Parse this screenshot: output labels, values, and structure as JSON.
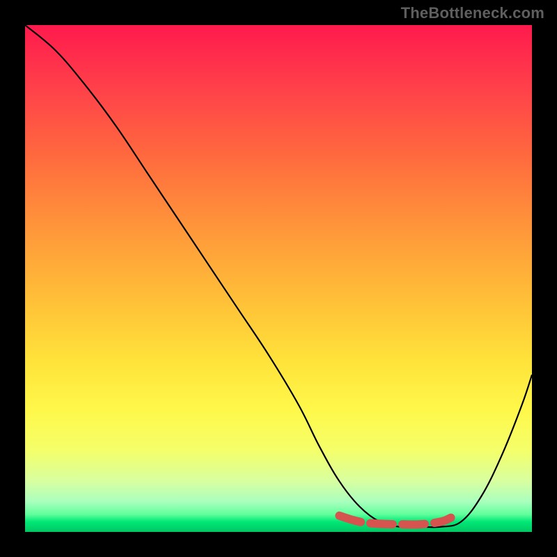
{
  "watermark": "TheBottleneck.com",
  "chart_data": {
    "type": "line",
    "title": "",
    "xlabel": "",
    "ylabel": "",
    "xlim": [
      0,
      100
    ],
    "ylim": [
      0,
      100
    ],
    "background_gradient": {
      "top": "#ff1a4d",
      "bottom": "#00c763",
      "meaning": "bottleneck severity high (red) to low (green)"
    },
    "series": [
      {
        "name": "bottleneck-curve",
        "color": "#000000",
        "stroke_width": 2,
        "x": [
          0,
          6,
          12,
          18,
          24,
          30,
          36,
          42,
          48,
          54,
          58,
          62,
          66,
          70,
          74,
          78,
          82,
          86,
          90,
          94,
          98,
          100
        ],
        "y": [
          100,
          95,
          88,
          80,
          71,
          62,
          53,
          44,
          35,
          25,
          17,
          10,
          5,
          2,
          1,
          1,
          1,
          2,
          7,
          15,
          25,
          31
        ]
      },
      {
        "name": "optimal-range-marker",
        "color": "#d5544f",
        "stroke_width": 12,
        "dash": "32 14",
        "linecap": "round",
        "x": [
          62,
          66,
          70,
          74,
          78,
          82,
          84
        ],
        "y": [
          3.2,
          2.0,
          1.6,
          1.5,
          1.5,
          2.0,
          2.8
        ]
      }
    ]
  }
}
